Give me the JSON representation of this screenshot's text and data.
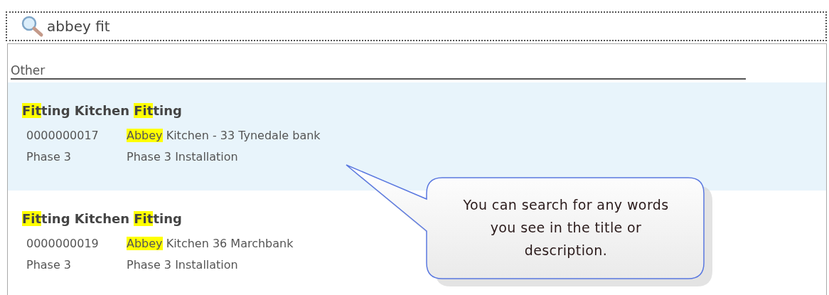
{
  "search": {
    "value": "abbey fit"
  },
  "group": {
    "label": "Other"
  },
  "results": [
    {
      "selected": true,
      "title": [
        {
          "text": "Fit",
          "highlighted": true
        },
        {
          "text": "ting Kitchen ",
          "highlighted": false
        },
        {
          "text": "Fit",
          "highlighted": true
        },
        {
          "text": "ting",
          "highlighted": false
        }
      ],
      "code": "0000000017",
      "description": [
        {
          "text": "Abbey",
          "highlighted": true
        },
        {
          "text": " Kitchen - 33 Tynedale bank",
          "highlighted": false
        }
      ],
      "phase": "Phase 3",
      "phase_description": "Phase 3 Installation"
    },
    {
      "selected": false,
      "title": [
        {
          "text": "Fit",
          "highlighted": true
        },
        {
          "text": "ting Kitchen ",
          "highlighted": false
        },
        {
          "text": "Fit",
          "highlighted": true
        },
        {
          "text": "ting",
          "highlighted": false
        }
      ],
      "code": "0000000019",
      "description": [
        {
          "text": "Abbey",
          "highlighted": true
        },
        {
          "text": " Kitchen 36 Marchbank",
          "highlighted": false
        }
      ],
      "phase": "Phase 3",
      "phase_description": "Phase 3 Installation"
    }
  ],
  "callout": {
    "text": "You can search for any words you see in the title or description."
  }
}
